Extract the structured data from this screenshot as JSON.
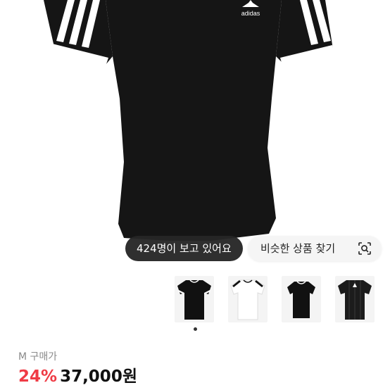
{
  "product": {
    "image_alt": "black t-shirt with white three stripes",
    "brand_logo_text": "adidas"
  },
  "overlay": {
    "viewers_text": "424명이 보고 있어요",
    "similar_label": "비슷한 상품 찾기",
    "similar_icon": "lens-search-icon"
  },
  "thumbnails": [
    {
      "label": "black tee white stripes",
      "color": "#111111",
      "trim": "#ffffff"
    },
    {
      "label": "white tee black stripes",
      "color": "#ffffff",
      "trim": "#111111"
    },
    {
      "label": "black tee",
      "color": "#111111",
      "trim": "#ffffff"
    },
    {
      "label": "black jersey",
      "color": "#1c1c1c",
      "trim": "#ffffff"
    }
  ],
  "carousel": {
    "active_index": 0
  },
  "pricing": {
    "size_prefix": "M",
    "label": "구매가",
    "discount": "24%",
    "price": "37,000원"
  },
  "colors": {
    "discount": "#ef3b45",
    "pill_dark": "#262626"
  }
}
